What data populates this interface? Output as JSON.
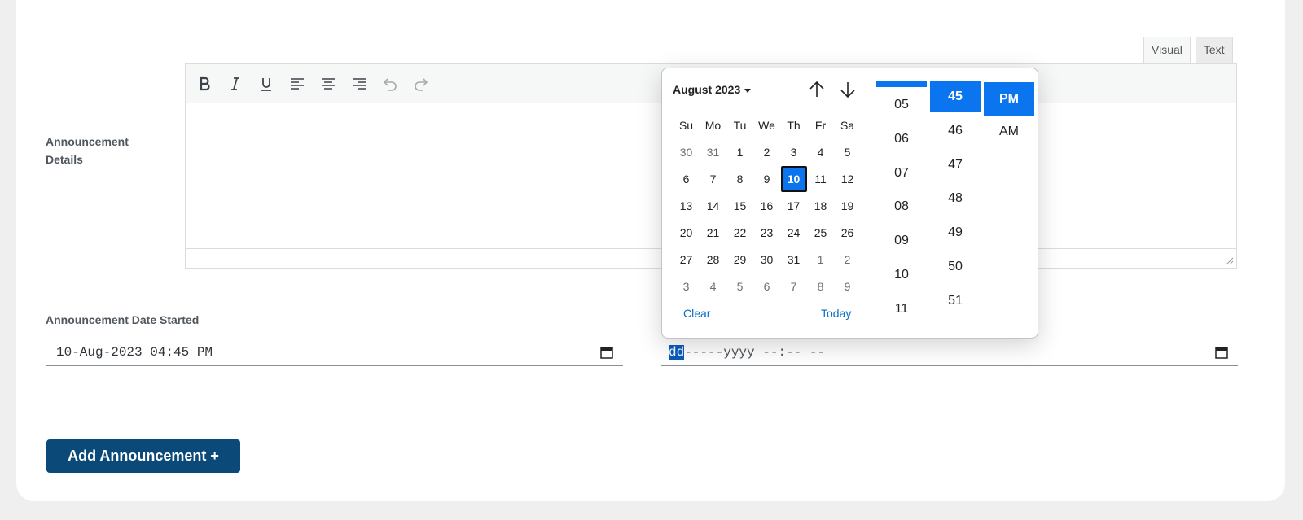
{
  "editor": {
    "tab_visual": "Visual",
    "tab_text": "Text",
    "label": "Announcement Details",
    "tools": [
      "bold-icon",
      "italic-icon",
      "underline-icon",
      "align-left-icon",
      "align-center-icon",
      "align-right-icon",
      "undo-icon",
      "redo-icon"
    ]
  },
  "start": {
    "label": "Announcement Date Started",
    "value": "10-Aug-2023 04:45 PM"
  },
  "end": {
    "seg_dd": "dd",
    "rest": "-----yyyy --:-- --"
  },
  "picker": {
    "month": "August 2023",
    "dow": [
      "Su",
      "Mo",
      "Tu",
      "We",
      "Th",
      "Fr",
      "Sa"
    ],
    "weeks": [
      [
        "30",
        "31",
        "1",
        "2",
        "3",
        "4",
        "5"
      ],
      [
        "6",
        "7",
        "8",
        "9",
        "10",
        "11",
        "12"
      ],
      [
        "13",
        "14",
        "15",
        "16",
        "17",
        "18",
        "19"
      ],
      [
        "20",
        "21",
        "22",
        "23",
        "24",
        "25",
        "26"
      ],
      [
        "27",
        "28",
        "29",
        "30",
        "31",
        "1",
        "2"
      ],
      [
        "3",
        "4",
        "5",
        "6",
        "7",
        "8",
        "9"
      ]
    ],
    "selected_day": "10",
    "clear": "Clear",
    "today": "Today",
    "hours": [
      "05",
      "06",
      "07",
      "08",
      "09",
      "10",
      "11"
    ],
    "minutes": [
      "45",
      "46",
      "47",
      "48",
      "49",
      "50",
      "51"
    ],
    "selected_minute": "45",
    "ampm": [
      "PM",
      "AM"
    ],
    "selected_ampm": "PM"
  },
  "actions": {
    "add": "Add Announcement +"
  },
  "colors": {
    "accent": "#0a75ef",
    "button": "#0b4a78"
  }
}
